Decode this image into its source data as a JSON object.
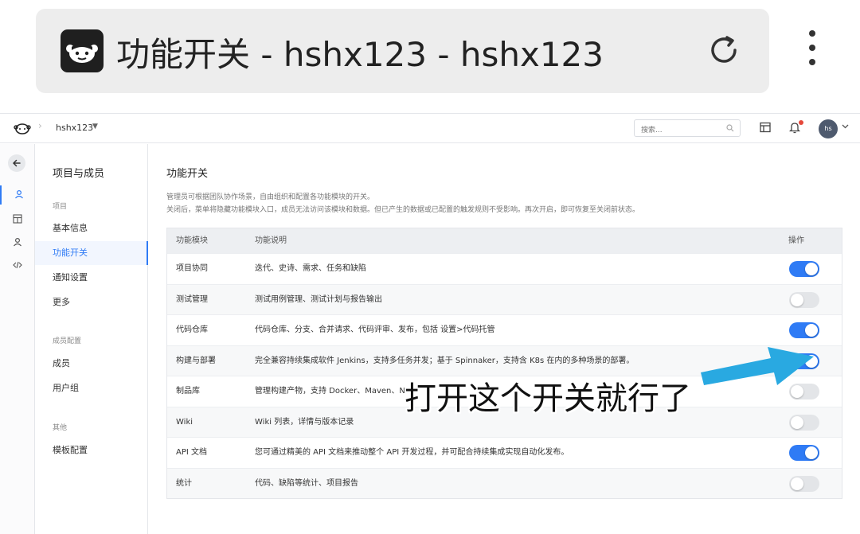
{
  "browser": {
    "title": "功能开关 - hshx123 - hshx123"
  },
  "header": {
    "project": "hshx123",
    "search_placeholder": "搜索...",
    "avatar_initials": "hs"
  },
  "sidebar": {
    "title": "项目与成员",
    "groups": [
      {
        "label": "项目",
        "items": [
          "基本信息",
          "功能开关",
          "通知设置",
          "更多"
        ]
      },
      {
        "label": "成员配置",
        "items": [
          "成员",
          "用户组"
        ]
      },
      {
        "label": "其他",
        "items": [
          "模板配置"
        ]
      }
    ],
    "active_item": "功能开关"
  },
  "main": {
    "title": "功能开关",
    "desc_line1": "管理员可根据团队协作场景，自由组织和配置各功能模块的开关。",
    "desc_line2": "关闭后，菜单将隐藏功能模块入口，成员无法访问该模块和数据。但已产生的数据或已配置的触发规则不受影响。再次开启，即可恢复至关闭前状态。",
    "columns": [
      "功能模块",
      "功能说明",
      "操作"
    ],
    "rows": [
      {
        "module": "项目协同",
        "description": "迭代、史诗、需求、任务和缺陷",
        "enabled": true
      },
      {
        "module": "测试管理",
        "description": "测试用例管理、测试计划与报告输出",
        "enabled": false
      },
      {
        "module": "代码仓库",
        "description": "代码仓库、分支、合并请求、代码评审、发布，包括 设置>代码托管",
        "enabled": true
      },
      {
        "module": "构建与部署",
        "description": "完全兼容持续集成软件 Jenkins，支持多任务并发；基于 Spinnaker，支持含 K8s 在内的多种场景的部署。",
        "enabled": true
      },
      {
        "module": "制品库",
        "description": "管理构建产物，支持 Docker、Maven、N",
        "enabled": false
      },
      {
        "module": "Wiki",
        "description": "Wiki 列表，详情与版本记录",
        "enabled": false
      },
      {
        "module": "API 文档",
        "description": "您可通过精美的 API 文档来推动整个 API 开发过程，并可配合持续集成实现自动化发布。",
        "enabled": true
      },
      {
        "module": "统计",
        "description": "代码、缺陷等统计、项目报告",
        "enabled": false
      }
    ]
  },
  "annotation": {
    "text": "打开这个开关就行了",
    "arrow_color": "#29a9e1"
  },
  "colors": {
    "accent": "#2f7bf5",
    "toggle_off": "#e3e5e8"
  }
}
